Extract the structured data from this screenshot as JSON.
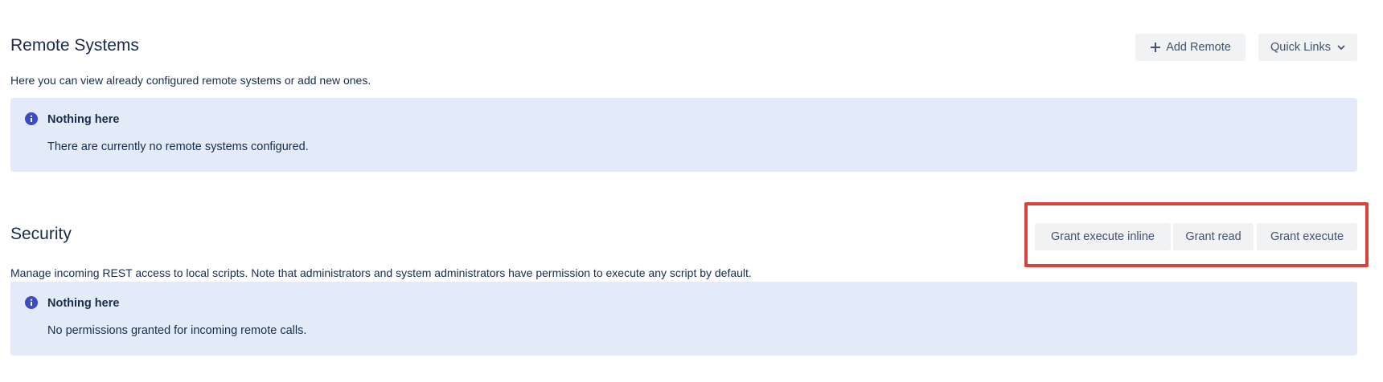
{
  "remote_systems": {
    "title": "Remote Systems",
    "description": "Here you can view already configured remote systems or add new ones.",
    "add_remote_label": "Add Remote",
    "quick_links_label": "Quick Links",
    "empty_state": {
      "title": "Nothing here",
      "body": "There are currently no remote systems configured."
    }
  },
  "security": {
    "title": "Security",
    "description": "Manage incoming REST access to local scripts. Note that administrators and system administrators have permission to execute any script by default.",
    "buttons": {
      "grant_execute_inline": "Grant execute inline",
      "grant_read": "Grant read",
      "grant_execute": "Grant execute"
    },
    "empty_state": {
      "title": "Nothing here",
      "body": "No permissions granted for incoming remote calls."
    }
  },
  "colors": {
    "panel_background": "#e3ebf9",
    "info_icon": "#3b4cc0",
    "highlight_border": "#d9423a",
    "button_background": "#f1f2f4"
  },
  "icons": {
    "info": "info-circle-icon",
    "add": "plus-icon",
    "dropdown": "chevron-down-icon"
  }
}
